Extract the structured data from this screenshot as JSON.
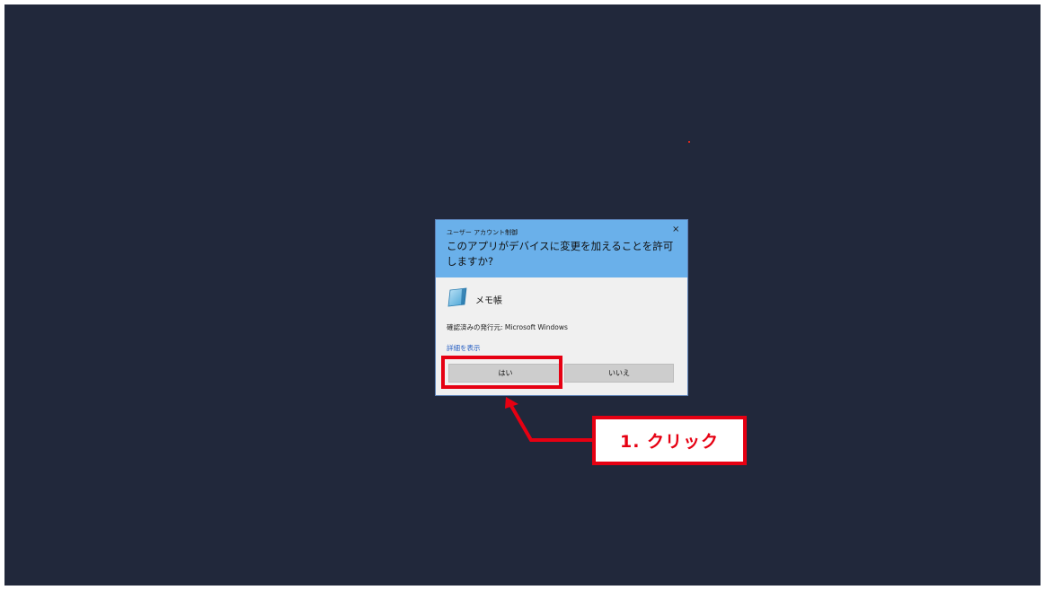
{
  "dialog": {
    "title": "ユーザー アカウント制御",
    "close_label": "×",
    "question": "このアプリがデバイスに変更を加えることを許可しますか?",
    "app_name": "メモ帳",
    "app_icon": "notepad-icon",
    "publisher": "確認済みの発行元: Microsoft Windows",
    "details_link": "詳細を表示",
    "yes_label": "はい",
    "no_label": "いいえ",
    "header_color": "#6ab0ea"
  },
  "annotation": {
    "step_label": "1. クリック",
    "color": "#e60012"
  },
  "desktop_color": "#21283b"
}
